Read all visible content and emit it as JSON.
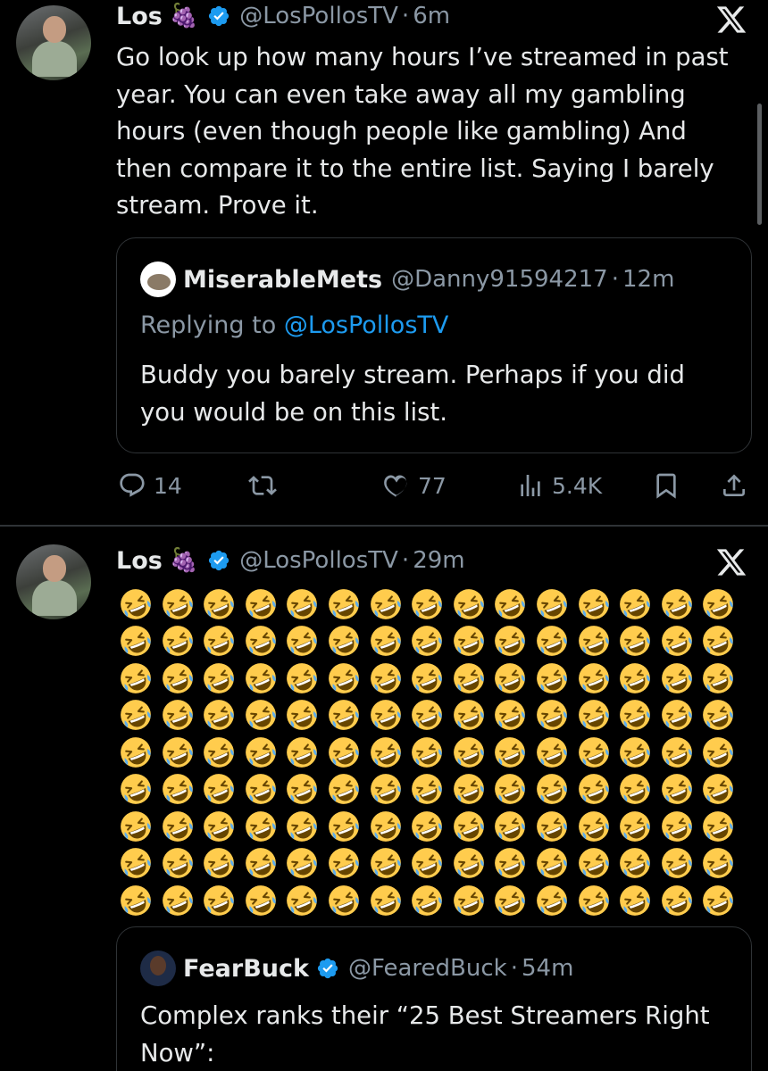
{
  "tweets": [
    {
      "author_name": "Los",
      "name_emoji": "🍇",
      "handle": "@LosPollosTV",
      "separator": "·",
      "time": "6m",
      "text_lines": [
        "Go look up how many hours I’ve streamed in past",
        "year. You can even take away all my gambling",
        "hours (even though people like gambling) And",
        "then compare it to the entire list. Saying I barely",
        "stream. Prove it."
      ],
      "quote": {
        "author_name": "MiserableMets",
        "handle": "@Danny91594217",
        "separator": "·",
        "time": "12m",
        "replying_prefix": "Replying to ",
        "replying_handle": "@LosPollosTV",
        "text_lines": [
          "Buddy you barely stream. Perhaps if you did",
          "you would be on this list."
        ]
      },
      "actions": {
        "replies": "14",
        "reposts": "",
        "likes": "77",
        "views": "5.4K"
      }
    },
    {
      "author_name": "Los",
      "name_emoji": "🍇",
      "handle": "@LosPollosTV",
      "separator": "·",
      "time": "29m",
      "emoji": "🤣",
      "emoji_rows": 9,
      "emoji_cols": 15,
      "quote": {
        "author_name": "FearBuck",
        "handle": "@FearedBuck",
        "separator": "·",
        "time": "54m",
        "text_lines": [
          "Complex ranks their “25 Best Streamers Right",
          "Now”:"
        ]
      }
    }
  ],
  "colors": {
    "background": "#000000",
    "text": "#e7e9ea",
    "secondary": "#8b98a5",
    "link": "#1d9bf0",
    "verified": "#1d9bf0",
    "border": "#2f3336"
  },
  "icons": [
    "x-logo-icon",
    "verified-badge-icon",
    "reply-icon",
    "repost-icon",
    "like-icon",
    "views-icon",
    "bookmark-icon",
    "share-icon",
    "rofl-emoji-icon"
  ]
}
